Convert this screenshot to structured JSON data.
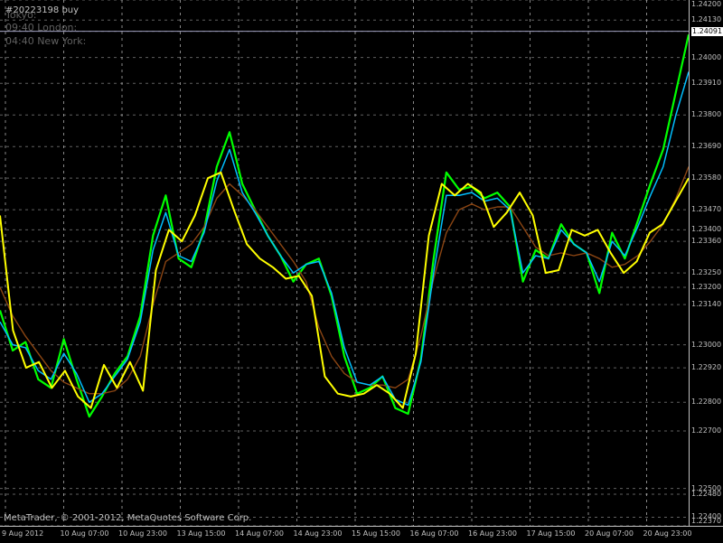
{
  "window": {
    "title": "#20223198 buy",
    "sessions": [
      "Tokyo:",
      "09:40 London:",
      "04:40 New York:"
    ],
    "copyright": "MetaTrader, © 2001-2012, MetaQuotes Software Corp."
  },
  "colors": {
    "background": "#000000",
    "grid": "#c0c0c0",
    "price_line": "#00ff00",
    "fast_ma": "#00bfff",
    "slow_ma": "#ffff00",
    "long_ma": "#8b4513"
  },
  "price_scale": {
    "labels": [
      "1.24200",
      "1.24130",
      "1.24091",
      "1.24000",
      "1.23910",
      "1.23800",
      "1.23690",
      "1.23580",
      "1.23470",
      "1.23400",
      "1.23360",
      "1.23250",
      "1.23200",
      "1.23140",
      "1.23000",
      "1.22920",
      "1.22800",
      "1.22700",
      "1.22500",
      "1.22480",
      "1.22400",
      "1.22370"
    ],
    "highlighted": [
      "1.24091"
    ]
  },
  "time_axis": {
    "labels": [
      "9 Aug 2012",
      "10 Aug 07:00",
      "10 Aug 23:00",
      "13 Aug 15:00",
      "14 Aug 07:00",
      "14 Aug 23:00",
      "15 Aug 15:00",
      "16 Aug 07:00",
      "16 Aug 23:00",
      "17 Aug 15:00",
      "20 Aug 07:00",
      "20 Aug 23:00"
    ]
  },
  "chart_data": {
    "type": "line",
    "ylim": [
      1.2237,
      1.242
    ],
    "series": [
      {
        "values": [
          1.2312,
          1.2298,
          1.2301,
          1.2288,
          1.2285,
          1.2302,
          1.2288,
          1.2275,
          1.2282,
          1.229,
          1.2296,
          1.231,
          1.2338,
          1.2352,
          1.233,
          1.2327,
          1.234,
          1.2362,
          1.2374,
          1.2356,
          1.2347,
          1.2338,
          1.2331,
          1.2322,
          1.2328,
          1.233,
          1.2317,
          1.2296,
          1.2283,
          1.2285,
          1.2289,
          1.2278,
          1.2276,
          1.2295,
          1.233,
          1.236,
          1.2354,
          1.2355,
          1.2351,
          1.2353,
          1.2348,
          1.2322,
          1.2333,
          1.233,
          1.2342,
          1.2335,
          1.2332,
          1.2318,
          1.2339,
          1.233,
          1.2343,
          1.2356,
          1.2368,
          1.2388,
          1.2408
        ]
      },
      {
        "values": [
          1.2308,
          1.23,
          1.2299,
          1.2291,
          1.2288,
          1.2297,
          1.229,
          1.228,
          1.2283,
          1.2289,
          1.2295,
          1.2308,
          1.2333,
          1.2346,
          1.2331,
          1.2329,
          1.2339,
          1.2357,
          1.2368,
          1.2353,
          1.2346,
          1.2338,
          1.2331,
          1.2325,
          1.2328,
          1.2329,
          1.2318,
          1.2299,
          1.2287,
          1.2286,
          1.2289,
          1.2281,
          1.2279,
          1.2294,
          1.2325,
          1.2352,
          1.2352,
          1.2353,
          1.235,
          1.2351,
          1.2347,
          1.2325,
          1.2331,
          1.233,
          1.234,
          1.2335,
          1.2332,
          1.2322,
          1.2336,
          1.2331,
          1.2341,
          1.2352,
          1.2362,
          1.238,
          1.2395
        ]
      },
      {
        "values": [
          1.2345,
          1.2305,
          1.2292,
          1.2294,
          1.2285,
          1.2291,
          1.2282,
          1.2278,
          1.2293,
          1.2285,
          1.2294,
          1.2284,
          1.2326,
          1.234,
          1.2336,
          1.2345,
          1.2358,
          1.236,
          1.2347,
          1.2335,
          1.233,
          1.2327,
          1.2323,
          1.2324,
          1.2317,
          1.2289,
          1.2283,
          1.2282,
          1.2283,
          1.2286,
          1.2283,
          1.2278,
          1.2297,
          1.2338,
          1.2356,
          1.2352,
          1.2356,
          1.2353,
          1.2341,
          1.2346,
          1.2353,
          1.2345,
          1.2325,
          1.2326,
          1.234,
          1.2338,
          1.234,
          1.2332,
          1.2325,
          1.2329,
          1.2339,
          1.2342,
          1.235,
          1.2358
        ]
      },
      {
        "values": [
          1.232,
          1.231,
          1.2303,
          1.2297,
          1.2291,
          1.2287,
          1.2285,
          1.2283,
          1.2283,
          1.2284,
          1.2288,
          1.2296,
          1.2314,
          1.2329,
          1.2332,
          1.2335,
          1.2341,
          1.2351,
          1.2356,
          1.2352,
          1.2347,
          1.2341,
          1.2335,
          1.2329,
          1.2322,
          1.2306,
          1.2296,
          1.229,
          1.2287,
          1.2286,
          1.2286,
          1.2285,
          1.2288,
          1.2303,
          1.2323,
          1.2339,
          1.2347,
          1.2349,
          1.2347,
          1.2348,
          1.2348,
          1.2341,
          1.2334,
          1.2331,
          1.2332,
          1.2331,
          1.2332,
          1.233,
          1.2327,
          1.2328,
          1.2331,
          1.2336,
          1.2342,
          1.2351,
          1.2362
        ]
      }
    ]
  }
}
